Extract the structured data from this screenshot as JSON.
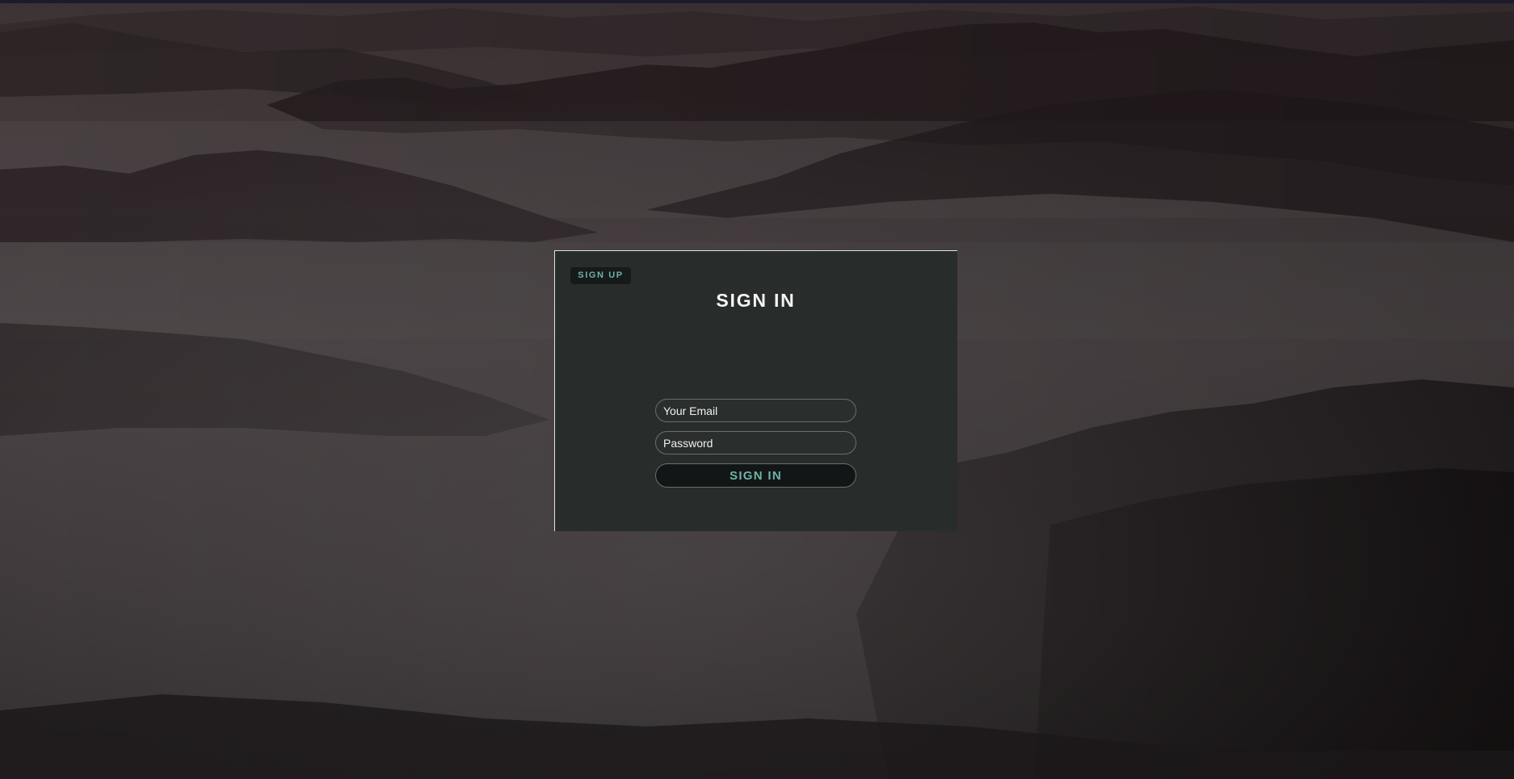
{
  "colors": {
    "background": "#3a3234",
    "panel": "#282c2b",
    "accent": "#6fb3a8",
    "title": "#f4f4f4"
  },
  "header": {
    "signup_label": "SIGN UP",
    "title": "SIGN IN"
  },
  "form": {
    "email_placeholder": "Your Email",
    "password_placeholder": "Password",
    "submit_label": "SIGN IN"
  }
}
